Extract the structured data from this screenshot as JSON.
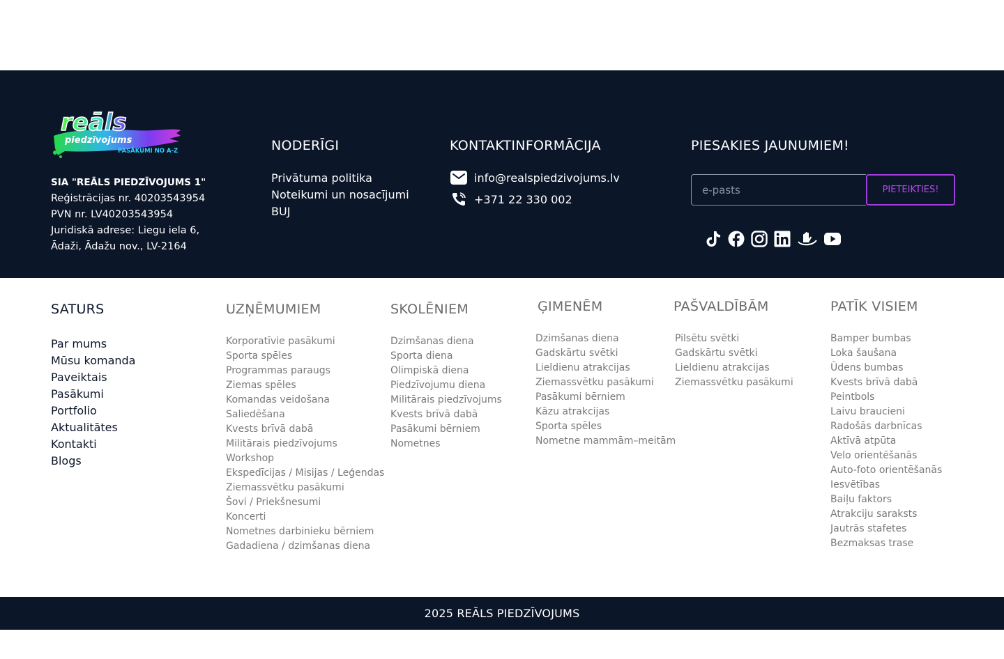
{
  "brand": {
    "logo_main": "reāls",
    "logo_sub": "piedzīvojums",
    "logo_tag": "PASĀKUMI NO A-Z"
  },
  "company": {
    "name": "SIA \"REĀLS PIEDZĪVOJUMS 1\"",
    "reg": "Reģistrācijas nr. 40203543954",
    "vat": "PVN nr. LV40203543954",
    "address1": "Juridiskā adrese: Liegu iela 6,",
    "address2": "Ādaži, Ādažu nov., LV-2164"
  },
  "noderigi": {
    "title": "NODERĪGI",
    "links": [
      "Privātuma politika",
      "Noteikumi un nosacījumi",
      "BUJ"
    ]
  },
  "kontakti": {
    "title": "KONTAKTINFORMĀCIJA",
    "email": "info@realspiedzivojums.lv",
    "phone": "+371 22 330 002"
  },
  "newsletter": {
    "title": "PIESAKIES JAUNUMIEM!",
    "placeholder": "e-pasts",
    "button": "PIETEIKTIES!"
  },
  "socials": [
    "tiktok-icon",
    "facebook-icon",
    "instagram-icon",
    "linkedin-icon",
    "hands-icon",
    "youtube-icon"
  ],
  "sitemap": {
    "saturs": {
      "title": "SATURS",
      "items": [
        "Par mums",
        "Mūsu komanda",
        "Paveiktais",
        "Pasākumi",
        "Portfolio",
        "Aktualitātes",
        "Kontakti",
        "Blogs"
      ]
    },
    "uznemumiem": {
      "title": "UZŅĒMUMIEM",
      "items": [
        "Korporatīvie pasākumi",
        "Sporta spēles",
        "Programmas paraugs",
        "Ziemas spēles",
        "Komandas veidošana",
        "Saliedēšana",
        "Kvests brīvā dabā",
        "Militārais piedzīvojums",
        "Workshop",
        "Ekspedīcijas / Misijas / Leģendas",
        "Ziemassvētku pasākumi",
        "Šovi / Priekšnesumi",
        "Koncerti",
        "Nometnes darbinieku bērniem",
        "Gadadiena / dzimšanas diena"
      ]
    },
    "skoleniem": {
      "title": "SKOLĒNIEM",
      "items": [
        "Dzimšanas diena",
        "Sporta diena",
        "Olimpiskā diena",
        "Piedzīvojumu diena",
        "Militārais piedzīvojums",
        "Kvests brīvā dabā",
        "Pasākumi bērniem",
        "Nometnes"
      ]
    },
    "gimenem": {
      "title": "ĢIMENĒM",
      "items": [
        "Dzimšanas diena",
        "Gadskārtu svētki",
        "Lieldienu atrakcijas",
        "Ziemassvētku pasākumi",
        "Pasākumi bērniem",
        "Kāzu atrakcijas",
        "Sporta spēles",
        "Nometne mammām–meitām"
      ]
    },
    "pasvaldibam": {
      "title": "PAŠVALDĪBĀM",
      "items": [
        "Pilsētu svētki",
        "Gadskārtu svētki",
        "Lieldienu atrakcijas",
        "Ziemassvētku pasākumi"
      ]
    },
    "patik_visiem": {
      "title": "PATĪK VISIEM",
      "items": [
        "Bamper bumbas",
        "Loka šaušana",
        "Ūdens bumbas",
        "Kvests brīvā dabā",
        "Peintbols",
        "Laivu braucieni",
        "Radošās darbnīcas",
        "Aktīvā atpūta",
        "Velo orientēšanās",
        "Auto-foto orientēšanās",
        "Iesvētības",
        "Baiļu faktors",
        "Atrakciju saraksts",
        "Jautrās stafetes",
        "Bezmaksas trase"
      ]
    }
  },
  "copyright": "2025 REĀLS PIEDZĪVOJUMS",
  "colors": {
    "navy": "#0b1629",
    "accent_purple": "#a23de0",
    "muted_text": "#7a7a7a"
  }
}
